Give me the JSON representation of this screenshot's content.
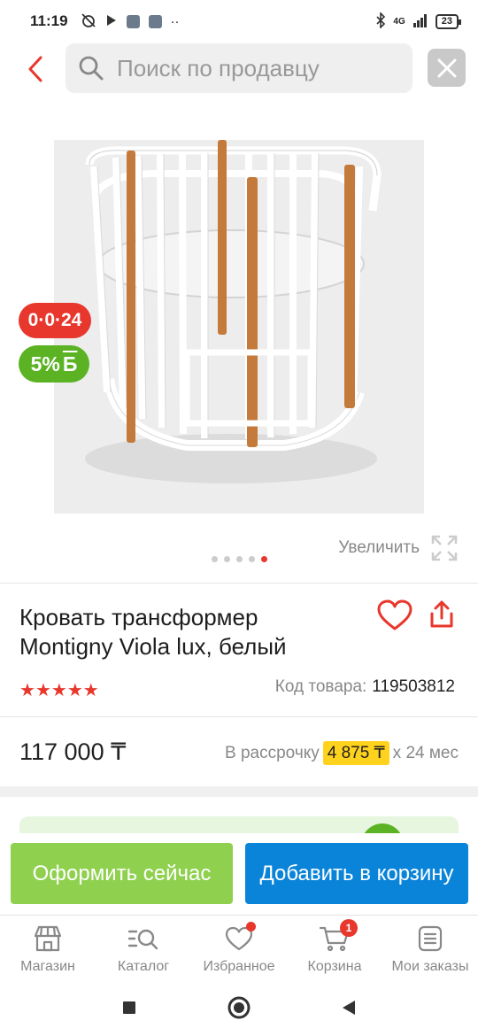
{
  "status_bar": {
    "time": "11:19",
    "network": "4G",
    "battery": "23"
  },
  "search": {
    "placeholder": "Поиск по продавцу"
  },
  "gallery": {
    "timer_badge": "0·0·24",
    "bonus_badge": "5%",
    "bonus_currency": "Б",
    "zoom_label": "Увеличить",
    "dots_count": 5,
    "active_dot": 5
  },
  "product": {
    "title": "Кровать трансформер Montigny Viola lux, белый",
    "rating_stars": 5,
    "sku_label": "Код товара:",
    "sku_value": "119503812"
  },
  "price": {
    "value": "117 000 ₸",
    "installment_prefix": "В рассрочку",
    "installment_amount": "4 875 ₸",
    "installment_suffix": "х 24 мес"
  },
  "actions": {
    "buy_now": "Оформить сейчас",
    "add_to_cart": "Добавить в корзину"
  },
  "bottom_nav": {
    "items": [
      {
        "label": "Магазин",
        "icon": "store-icon"
      },
      {
        "label": "Каталог",
        "icon": "catalog-search-icon"
      },
      {
        "label": "Избранное",
        "icon": "heart-icon"
      },
      {
        "label": "Корзина",
        "icon": "cart-icon",
        "badge": "1"
      },
      {
        "label": "Мои заказы",
        "icon": "orders-icon"
      }
    ]
  },
  "colors": {
    "accent": "#e8372d",
    "green": "#5bb324",
    "buy_button": "#8fd14f",
    "cart_button": "#0a84d9",
    "installment_highlight": "#ffd21e"
  }
}
